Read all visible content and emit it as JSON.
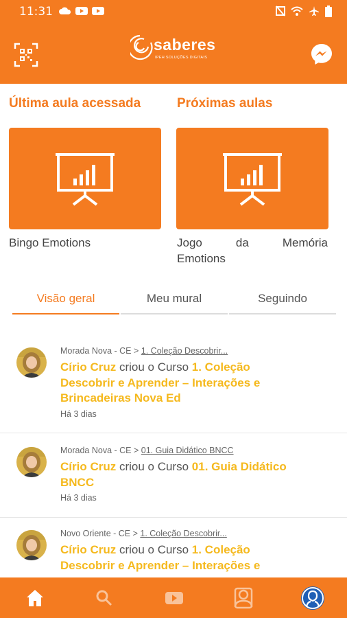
{
  "status_bar": {
    "time": "11:31",
    "left_icons": [
      "cloud-icon",
      "youtube-icon",
      "youtube-icon"
    ],
    "right_icons": [
      "nfc-icon",
      "wifi-icon",
      "airplane-icon",
      "battery-icon"
    ]
  },
  "header": {
    "logo_text": "saberes",
    "logo_subtext": "IPEH SOLUÇÕES DIGITAIS",
    "left_icon": "qr-code-icon",
    "right_icon": "messenger-icon"
  },
  "last_lesson": {
    "title": "Última aula acessada",
    "card_icon": "presentation-chart-icon",
    "label": "Bingo Emotions"
  },
  "next_lessons": {
    "title": "Próximas aulas",
    "card_icon": "presentation-chart-icon",
    "label_words": [
      "Jogo",
      "da",
      "Memória"
    ],
    "label_line2": "Emotions"
  },
  "tabs": [
    {
      "label": "Visão geral",
      "active": true
    },
    {
      "label": "Meu mural",
      "active": false
    },
    {
      "label": "Seguindo",
      "active": false
    }
  ],
  "feed": [
    {
      "location": "Morada Nova - CE >",
      "course_link": "1. Coleção Descobrir...",
      "author": "Círio Cruz",
      "action": " criou o Curso ",
      "course": "1. Coleção Descobrir e Aprender – Interações e Brincadeiras Nova Ed",
      "time": "Há 3 dias"
    },
    {
      "location": "Morada Nova - CE >",
      "course_link": "01. Guia Didático BNCC",
      "author": "Círio Cruz",
      "action": " criou o Curso ",
      "course": "01. Guia Didático BNCC",
      "time": "Há 3 dias"
    },
    {
      "location": "Novo Oriente - CE >",
      "course_link": "1. Coleção Descobrir...",
      "author": "Círio Cruz",
      "action": " criou o Curso ",
      "course": "1. Coleção Descobrir e Aprender – Interações e",
      "time": ""
    }
  ],
  "bottom_nav": [
    "home-icon",
    "search-icon",
    "video-icon",
    "contacts-icon",
    "profile-icon"
  ],
  "colors": {
    "brand": "#f47b20",
    "highlight": "#f5b91e"
  }
}
